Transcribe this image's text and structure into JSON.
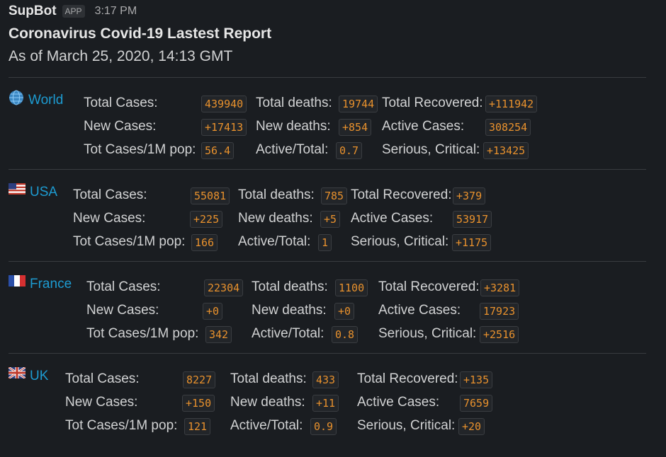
{
  "header": {
    "bot_name": "SupBot",
    "app_badge": "APP",
    "time": "3:17 PM"
  },
  "report": {
    "title": "Coronavirus Covid-19 Lastest Report",
    "date": "As of March 25, 2020, 14:13 GMT"
  },
  "labels": {
    "total_cases": "Total Cases:",
    "new_cases": "New Cases:",
    "tot_cases_1m": "Tot Cases/1M pop:",
    "total_deaths": "Total deaths:",
    "new_deaths": "New deaths:",
    "active_total": "Active/Total:",
    "total_recovered": "Total Recovered:",
    "active_cases": "Active Cases:",
    "serious_critical": "Serious, Critical:"
  },
  "icons": {
    "world": "globe-icon",
    "usa": "us-flag-icon",
    "france": "france-flag-icon",
    "uk": "uk-flag-icon"
  },
  "colors": {
    "link": "#1d9bd1",
    "value": "#e8912d",
    "background": "#1a1d21"
  },
  "sections": [
    {
      "country": "World",
      "total_cases": "439940",
      "new_cases": "+17413",
      "tot_cases_1m": "56.4",
      "total_deaths": "19744",
      "new_deaths": "+854",
      "active_total": "0.7",
      "total_recovered": "+111942",
      "active_cases": "308254",
      "serious_critical": "+13425"
    },
    {
      "country": "USA",
      "total_cases": "55081",
      "new_cases": "+225",
      "tot_cases_1m": "166",
      "total_deaths": "785",
      "new_deaths": "+5",
      "active_total": "1",
      "total_recovered": "+379",
      "active_cases": "53917",
      "serious_critical": "+1175"
    },
    {
      "country": "France",
      "total_cases": "22304",
      "new_cases": "+0",
      "tot_cases_1m": "342",
      "total_deaths": "1100",
      "new_deaths": "+0",
      "active_total": "0.8",
      "total_recovered": "+3281",
      "active_cases": "17923",
      "serious_critical": "+2516"
    },
    {
      "country": "UK",
      "total_cases": "8227",
      "new_cases": "+150",
      "tot_cases_1m": "121",
      "total_deaths": "433",
      "new_deaths": "+11",
      "active_total": "0.9",
      "total_recovered": "+135",
      "active_cases": "7659",
      "serious_critical": "+20"
    }
  ]
}
